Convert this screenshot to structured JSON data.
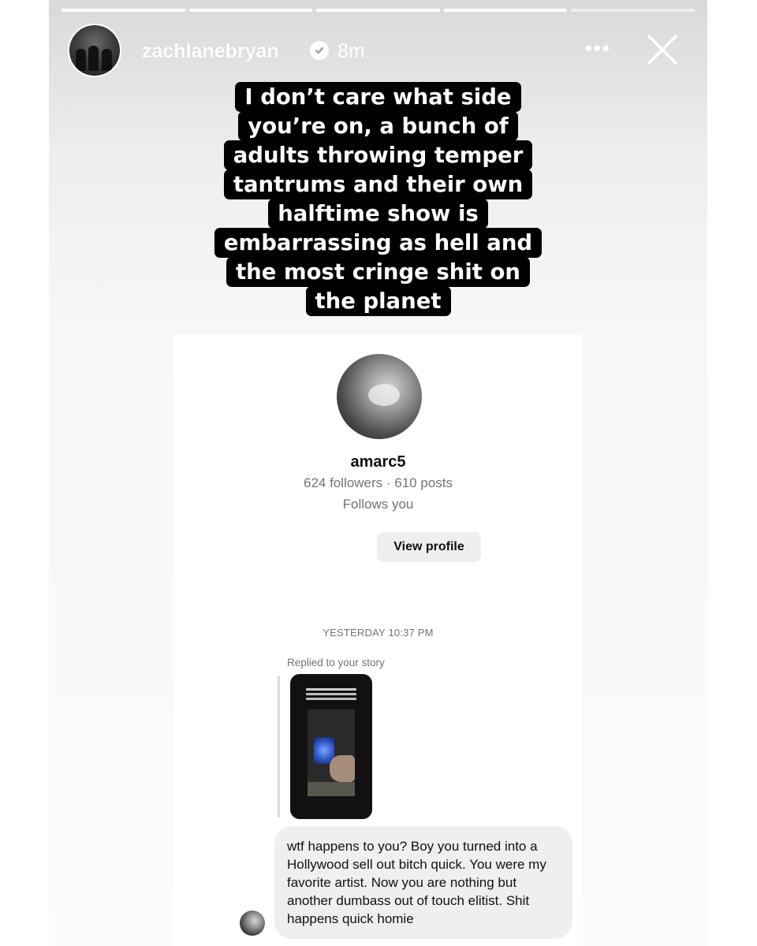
{
  "story": {
    "username": "zachlanebryan",
    "time_ago": "8m",
    "more_label": "•••",
    "progress_segments": 5,
    "progress_done": 4,
    "caption_lines": [
      "I don’t care what side",
      "you’re on, a bunch of",
      "adults throwing temper",
      "tantrums and their own",
      "halftime show is",
      "embarrassing as hell and",
      "the most cringe shit on",
      "the planet"
    ]
  },
  "dm": {
    "profile": {
      "name": "amarc5",
      "stats": "624 followers · 610 posts",
      "follows": "Follows you",
      "view_profile_label": "View profile"
    },
    "timestamp": "YESTERDAY 10:37 PM",
    "replied_label": "Replied to your story",
    "message": "wtf happens to you? Boy you turned into a Hollywood sell out bitch quick. You were my favorite artist. Now you are nothing but another dumbass out of touch elitist. Shit happens quick homie"
  },
  "colors": {
    "caption_bg": "#000000",
    "bubble_bg": "#efefef",
    "muted_text": "#737373"
  },
  "icons": [
    "verified-icon",
    "more-icon",
    "close-icon"
  ]
}
